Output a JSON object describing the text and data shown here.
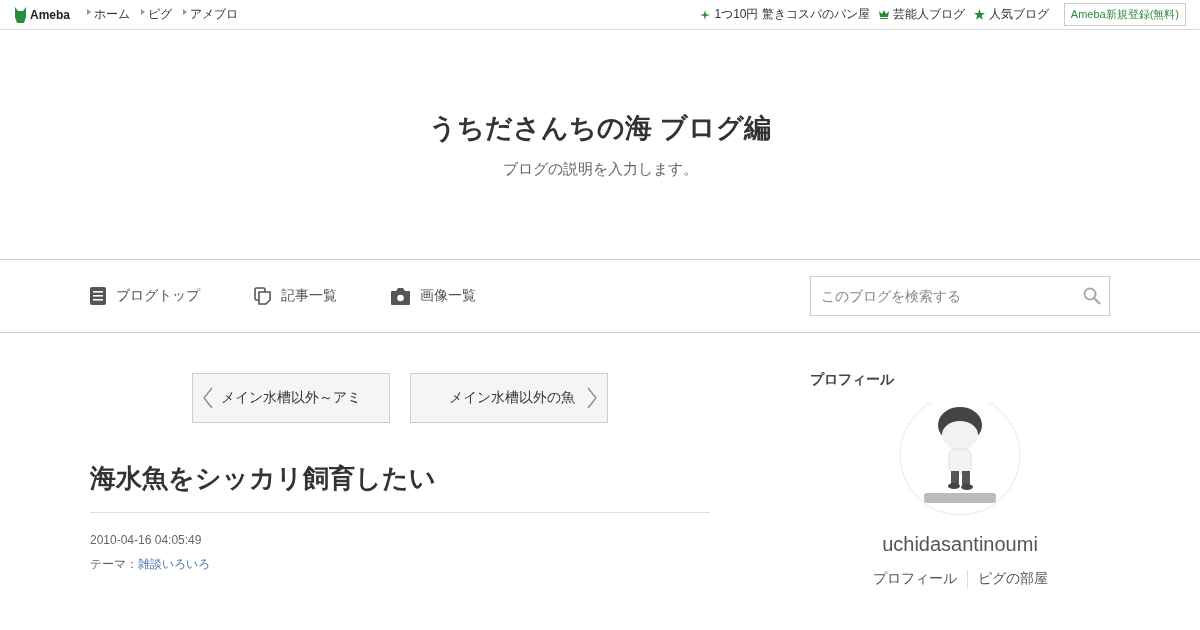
{
  "topbar": {
    "logo": "Ameba",
    "links": [
      "ホーム",
      "ピグ",
      "アメブロ"
    ],
    "right_links": [
      {
        "kind": "sparkle",
        "label": "1つ10円 驚きコスパのパン屋"
      },
      {
        "kind": "crown",
        "label": "芸能人ブログ"
      },
      {
        "kind": "star",
        "label": "人気ブログ"
      }
    ],
    "register": "Ameba新規登録(無料)"
  },
  "header": {
    "title": "うちださんちの海 ブログ編",
    "description": "ブログの説明を入力します。"
  },
  "nav": {
    "items": [
      {
        "kind": "doc",
        "label": "ブログトップ"
      },
      {
        "kind": "copy",
        "label": "記事一覧"
      },
      {
        "kind": "camera",
        "label": "画像一覧"
      }
    ],
    "search": {
      "placeholder": "このブログを検索する"
    }
  },
  "pager": {
    "prev": "メイン水槽以外～アミ",
    "next": "メイン水槽以外の魚"
  },
  "article": {
    "title": "海水魚をシッカリ飼育したい",
    "date": "2010-04-16 04:05:49",
    "theme_label": "テーマ：",
    "theme": "雑談いろいろ"
  },
  "profile": {
    "heading": "プロフィール",
    "name": "uchidasantinoumi",
    "links": [
      "プロフィール",
      "ピグの部屋"
    ]
  }
}
